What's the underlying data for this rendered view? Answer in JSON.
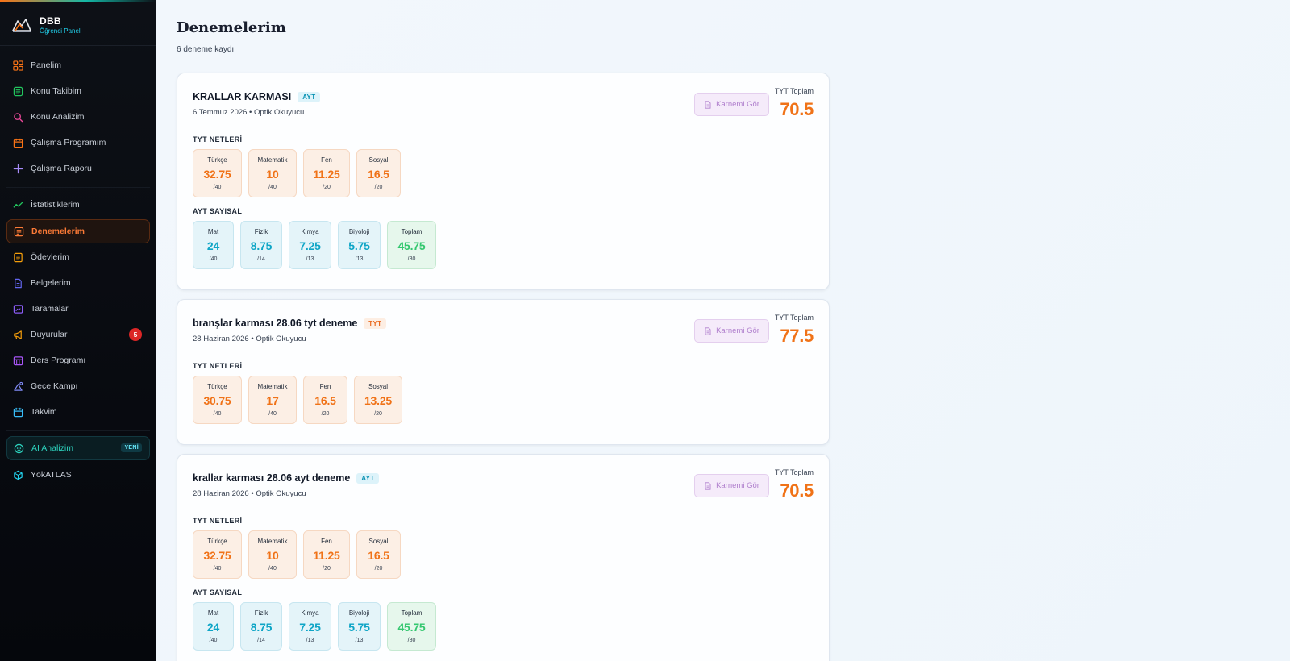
{
  "brand": {
    "name": "DBB",
    "subtitle": "Öğrenci Paneli"
  },
  "sidebar": {
    "items": [
      {
        "label": "Panelim",
        "icon": "grid-icon"
      },
      {
        "label": "Konu Takibim",
        "icon": "list-check-icon"
      },
      {
        "label": "Konu Analizim",
        "icon": "magnifier-icon"
      },
      {
        "label": "Çalışma Programım",
        "icon": "calendar-icon"
      },
      {
        "label": "Çalışma Raporu",
        "icon": "plus-icon"
      },
      {
        "label": "İstatistiklerim",
        "icon": "trend-line-icon"
      },
      {
        "label": "Denemelerim",
        "icon": "document-icon",
        "active": true
      },
      {
        "label": "Ödevlerim",
        "icon": "clipboard-icon"
      },
      {
        "label": "Belgelerim",
        "icon": "file-icon"
      },
      {
        "label": "Taramalar",
        "icon": "scan-icon"
      },
      {
        "label": "Duyurular",
        "icon": "megaphone-icon",
        "badge": "5"
      },
      {
        "label": "Ders Programı",
        "icon": "timetable-icon"
      },
      {
        "label": "Gece Kampı",
        "icon": "moon-camp-icon"
      },
      {
        "label": "Takvim",
        "icon": "calendar-icon"
      },
      {
        "label": "AI Analizim",
        "icon": "ai-icon",
        "badge": "YENİ"
      },
      {
        "label": "YökATLAS",
        "icon": "cube-icon"
      }
    ],
    "colors": {
      "active": "#fb7a36",
      "ai": "#2dd4bf",
      "badge": "#dc2626"
    }
  },
  "page": {
    "title": "Denemelerim",
    "count": "6 deneme kaydı"
  },
  "common": {
    "karne_button": "Karnemi Gör",
    "total_label": "TYT Toplam",
    "tyt_section": "TYT NETLERİ",
    "ayt_section": "AYT SAYISAL"
  },
  "exams": [
    {
      "name": "KRALLAR KARMASI",
      "tag": "AYT",
      "meta": "6 Temmuz 2026 • Optik Okuyucu",
      "total": "70.5",
      "tyt": [
        {
          "label": "Türkçe",
          "value": "32.75",
          "max": "/40"
        },
        {
          "label": "Matematik",
          "value": "10",
          "max": "/40"
        },
        {
          "label": "Fen",
          "value": "11.25",
          "max": "/20"
        },
        {
          "label": "Sosyal",
          "value": "16.5",
          "max": "/20"
        }
      ],
      "ayt": [
        {
          "label": "Mat",
          "value": "24",
          "max": "/40"
        },
        {
          "label": "Fizik",
          "value": "8.75",
          "max": "/14"
        },
        {
          "label": "Kimya",
          "value": "7.25",
          "max": "/13"
        },
        {
          "label": "Biyoloji",
          "value": "5.75",
          "max": "/13"
        },
        {
          "label": "Toplam",
          "value": "45.75",
          "max": "/80"
        }
      ]
    },
    {
      "name": "branşlar karması 28.06 tyt deneme",
      "tag": "TYT",
      "meta": "28 Haziran 2026 • Optik Okuyucu",
      "total": "77.5",
      "tyt": [
        {
          "label": "Türkçe",
          "value": "30.75",
          "max": "/40"
        },
        {
          "label": "Matematik",
          "value": "17",
          "max": "/40"
        },
        {
          "label": "Fen",
          "value": "16.5",
          "max": "/20"
        },
        {
          "label": "Sosyal",
          "value": "13.25",
          "max": "/20"
        }
      ]
    },
    {
      "name": "krallar karması 28.06 ayt deneme",
      "tag": "AYT",
      "meta": "28 Haziran 2026 • Optik Okuyucu",
      "total": "70.5",
      "tyt": [
        {
          "label": "Türkçe",
          "value": "32.75",
          "max": "/40"
        },
        {
          "label": "Matematik",
          "value": "10",
          "max": "/40"
        },
        {
          "label": "Fen",
          "value": "11.25",
          "max": "/20"
        },
        {
          "label": "Sosyal",
          "value": "16.5",
          "max": "/20"
        }
      ],
      "ayt": [
        {
          "label": "Mat",
          "value": "24",
          "max": "/40"
        },
        {
          "label": "Fizik",
          "value": "8.75",
          "max": "/14"
        },
        {
          "label": "Kimya",
          "value": "7.25",
          "max": "/13"
        },
        {
          "label": "Biyoloji",
          "value": "5.75",
          "max": "/13"
        },
        {
          "label": "Toplam",
          "value": "45.75",
          "max": "/80"
        }
      ]
    }
  ]
}
